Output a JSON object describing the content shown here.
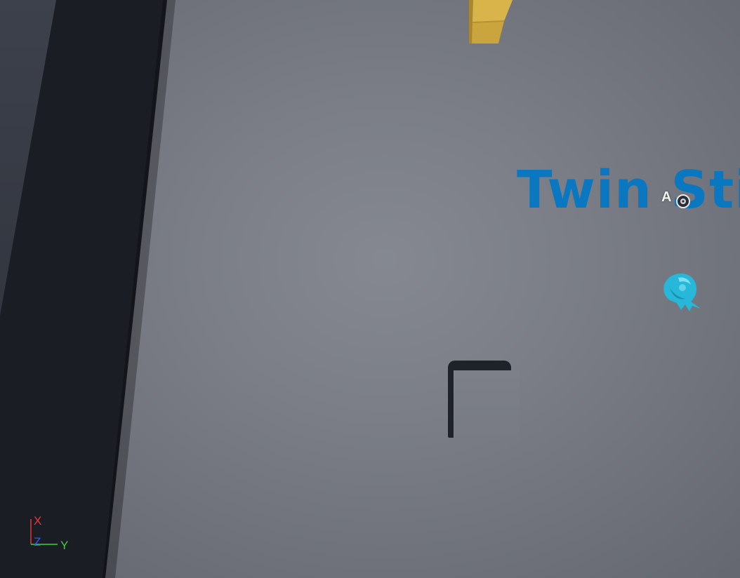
{
  "scene": {
    "title_text": "Twin Sti",
    "actor_label": "A"
  },
  "axis": {
    "x_label": "X",
    "y_label": "Y",
    "z_label": "Z",
    "x_color": "#e23a3a",
    "y_color": "#3ad23a",
    "z_color": "#2a5cff"
  },
  "colors": {
    "title": "#0a78c0",
    "ship": "#27b7d8",
    "block": "#d9b44a",
    "floor": "#7b7e87",
    "void": "#1b1d24"
  },
  "icons": {
    "ship": "ship-icon",
    "actor": "actor-sprite-icon",
    "axis": "axis-gizmo-icon"
  }
}
